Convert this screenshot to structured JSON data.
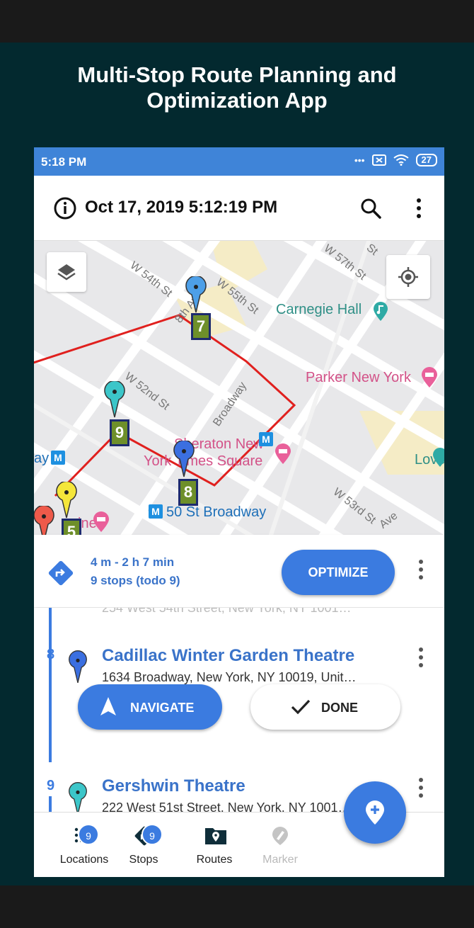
{
  "promo": {
    "headline_line1": "Multi-Stop Route Planning and",
    "headline_line2": "Optimization App"
  },
  "status_bar": {
    "time": "5:18 PM",
    "dots": "•••",
    "battery": "27"
  },
  "app_bar": {
    "title": "Oct 17, 2019 5:12:19 PM"
  },
  "map": {
    "streets": [
      "W 54th St",
      "W 55th St",
      "W 57th St",
      "8th Av",
      "W 52nd St",
      "Broadway",
      "W 53rd St",
      "Ave",
      "St"
    ],
    "pois": {
      "carnegie": "Carnegie Hall",
      "parker": "Parker New York",
      "sheraton1": "Sheraton New",
      "sheraton2": "York Times Square",
      "love": "Love",
      "station": "50 St Broadway",
      "left_station": "ay",
      "left_poi": "ines"
    },
    "badges": [
      "7",
      "9",
      "8",
      "5"
    ],
    "metro_icon": "M"
  },
  "summary": {
    "duration": "4 m - 2 h 7 min",
    "stops": "9 stops (todo 9)",
    "optimize_label": "OPTIMIZE"
  },
  "stops": [
    {
      "number": "8",
      "name": "Cadillac Winter Garden Theatre",
      "address": "1634 Broadway, New York,  NY 10019, Unit…",
      "pin_color": "#3b6fe0"
    },
    {
      "number": "9",
      "name": "Gershwin Theatre",
      "address": "222 West 51st Street, New York,  NY 1001…",
      "pin_color": "#3cc6c9"
    }
  ],
  "ghost_address": "254 West 54th Street, New York, NY 1001…",
  "actions": {
    "navigate_label": "NAVIGATE",
    "done_label": "DONE"
  },
  "bottom_nav": [
    {
      "label": "Locations",
      "badge": "9"
    },
    {
      "label": "Stops",
      "badge": "9"
    },
    {
      "label": "Routes"
    },
    {
      "label": "Marker"
    }
  ],
  "colors": {
    "teal_bg": "#03292f",
    "accent": "#3b7be0",
    "route": "#e0201e",
    "badge_green": "#6e8f2a"
  }
}
